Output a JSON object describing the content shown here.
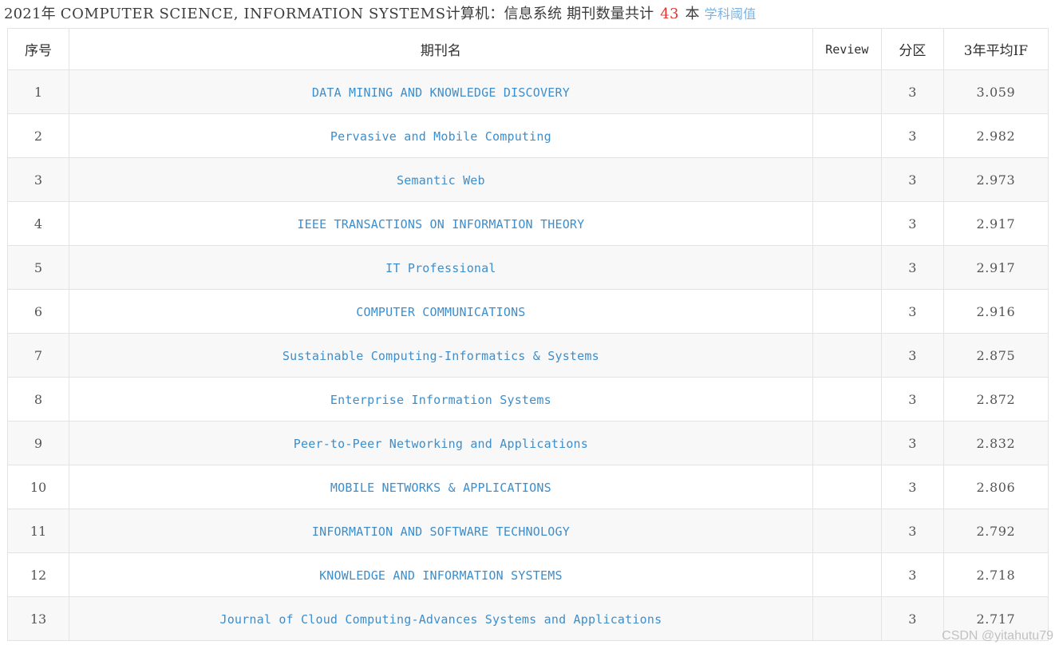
{
  "header": {
    "year": "2021年",
    "category_en": "COMPUTER SCIENCE, INFORMATION SYSTEMS",
    "category_zh": "计算机：信息系统",
    "count_label": "期刊数量共计",
    "count": "43",
    "count_unit": "本",
    "threshold_link": "学科阈值",
    "count_color": "#e2342c",
    "link_color": "#7fb2dd"
  },
  "table": {
    "columns": [
      {
        "key": "index",
        "label": "序号"
      },
      {
        "key": "name",
        "label": "期刊名"
      },
      {
        "key": "review",
        "label": "Review"
      },
      {
        "key": "zone",
        "label": "分区"
      },
      {
        "key": "avgif",
        "label": "3年平均IF"
      }
    ],
    "rows": [
      {
        "index": "1",
        "name": "DATA MINING AND KNOWLEDGE DISCOVERY",
        "review": "",
        "zone": "3",
        "avgif": "3.059"
      },
      {
        "index": "2",
        "name": "Pervasive and Mobile Computing",
        "review": "",
        "zone": "3",
        "avgif": "2.982"
      },
      {
        "index": "3",
        "name": "Semantic Web",
        "review": "",
        "zone": "3",
        "avgif": "2.973"
      },
      {
        "index": "4",
        "name": "IEEE TRANSACTIONS ON INFORMATION THEORY",
        "review": "",
        "zone": "3",
        "avgif": "2.917"
      },
      {
        "index": "5",
        "name": "IT Professional",
        "review": "",
        "zone": "3",
        "avgif": "2.917"
      },
      {
        "index": "6",
        "name": "COMPUTER COMMUNICATIONS",
        "review": "",
        "zone": "3",
        "avgif": "2.916"
      },
      {
        "index": "7",
        "name": "Sustainable Computing-Informatics & Systems",
        "review": "",
        "zone": "3",
        "avgif": "2.875"
      },
      {
        "index": "8",
        "name": "Enterprise Information Systems",
        "review": "",
        "zone": "3",
        "avgif": "2.872"
      },
      {
        "index": "9",
        "name": "Peer-to-Peer Networking and Applications",
        "review": "",
        "zone": "3",
        "avgif": "2.832"
      },
      {
        "index": "10",
        "name": "MOBILE NETWORKS & APPLICATIONS",
        "review": "",
        "zone": "3",
        "avgif": "2.806"
      },
      {
        "index": "11",
        "name": "INFORMATION AND SOFTWARE TECHNOLOGY",
        "review": "",
        "zone": "3",
        "avgif": "2.792"
      },
      {
        "index": "12",
        "name": "KNOWLEDGE AND INFORMATION SYSTEMS",
        "review": "",
        "zone": "3",
        "avgif": "2.718"
      },
      {
        "index": "13",
        "name": "Journal of Cloud Computing-Advances Systems and Applications",
        "review": "",
        "zone": "3",
        "avgif": "2.717"
      }
    ],
    "journal_link_color": "#3d8ecb",
    "stripe_color": "#f8f8f8",
    "border_color": "#e3e3e3"
  },
  "watermark": {
    "text": "CSDN @yitahutu79"
  }
}
